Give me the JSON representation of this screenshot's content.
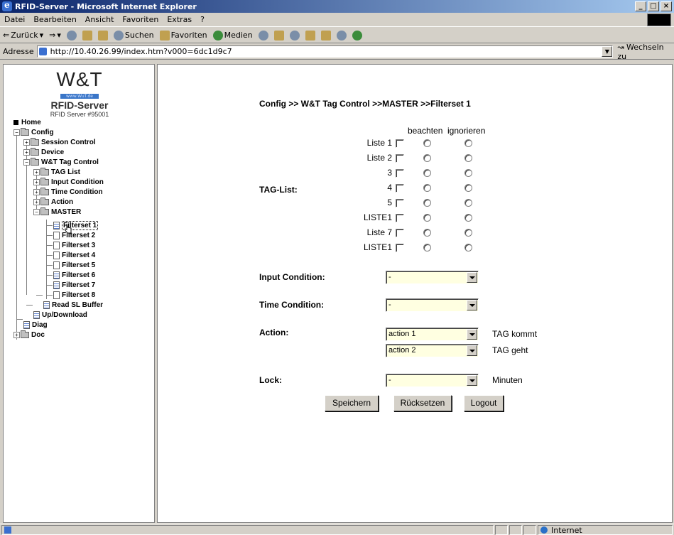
{
  "window": {
    "title": "RFID-Server - Microsoft Internet Explorer"
  },
  "menu": [
    "Datei",
    "Bearbeiten",
    "Ansicht",
    "Favoriten",
    "Extras",
    "?"
  ],
  "toolbar": {
    "back": "Zurück",
    "search": "Suchen",
    "favorites": "Favoriten",
    "media": "Medien"
  },
  "address": {
    "label": "Adresse",
    "url": "http://10.40.26.99/index.htm?v000=6dc1d9c7",
    "go": "Wechseln zu"
  },
  "status": {
    "zone": "Internet"
  },
  "logo": {
    "mark": "W&T",
    "url": "www.WuT.de",
    "product": "RFID-Server",
    "serial": "RFID Server #95001"
  },
  "tree": {
    "home": "Home",
    "config": "Config",
    "session_control": "Session Control",
    "device": "Device",
    "tag_control": "W&T Tag Control",
    "tag_list": "TAG List",
    "input_condition": "Input Condition",
    "time_condition": "Time Condition",
    "action": "Action",
    "master": "MASTER",
    "filtersets": [
      "Filterset 1",
      "Filterset 2",
      "Filterset 3",
      "Filterset 4",
      "Filterset 5",
      "Filterset 6",
      "Filterset 7",
      "Filterset 8"
    ],
    "read_sl_buffer": "Read SL Buffer",
    "updownload": "Up/Download",
    "diag": "Diag",
    "doc": "Doc"
  },
  "content": {
    "breadcrumb": "Config >> W&T Tag Control >>MASTER >>Filterset  1",
    "col_observe": "beachten",
    "col_ignore": "ignorieren",
    "tag_list_label": "TAG-List:",
    "tags": [
      "Liste 1",
      "Liste 2",
      "3",
      "4",
      "5",
      "LISTE1",
      "Liste 7",
      "LISTE1"
    ],
    "input_condition_label": "Input Condition:",
    "input_condition_value": "-",
    "time_condition_label": "Time Condition:",
    "time_condition_value": "-",
    "action_label": "Action:",
    "action1_value": "action 1",
    "action1_side": "TAG kommt",
    "action2_value": "action 2",
    "action2_side": "TAG geht",
    "lock_label": "Lock:",
    "lock_value": "-",
    "lock_side": "Minuten",
    "save": "Speichern",
    "reset": "Rücksetzen",
    "logout": "Logout"
  }
}
